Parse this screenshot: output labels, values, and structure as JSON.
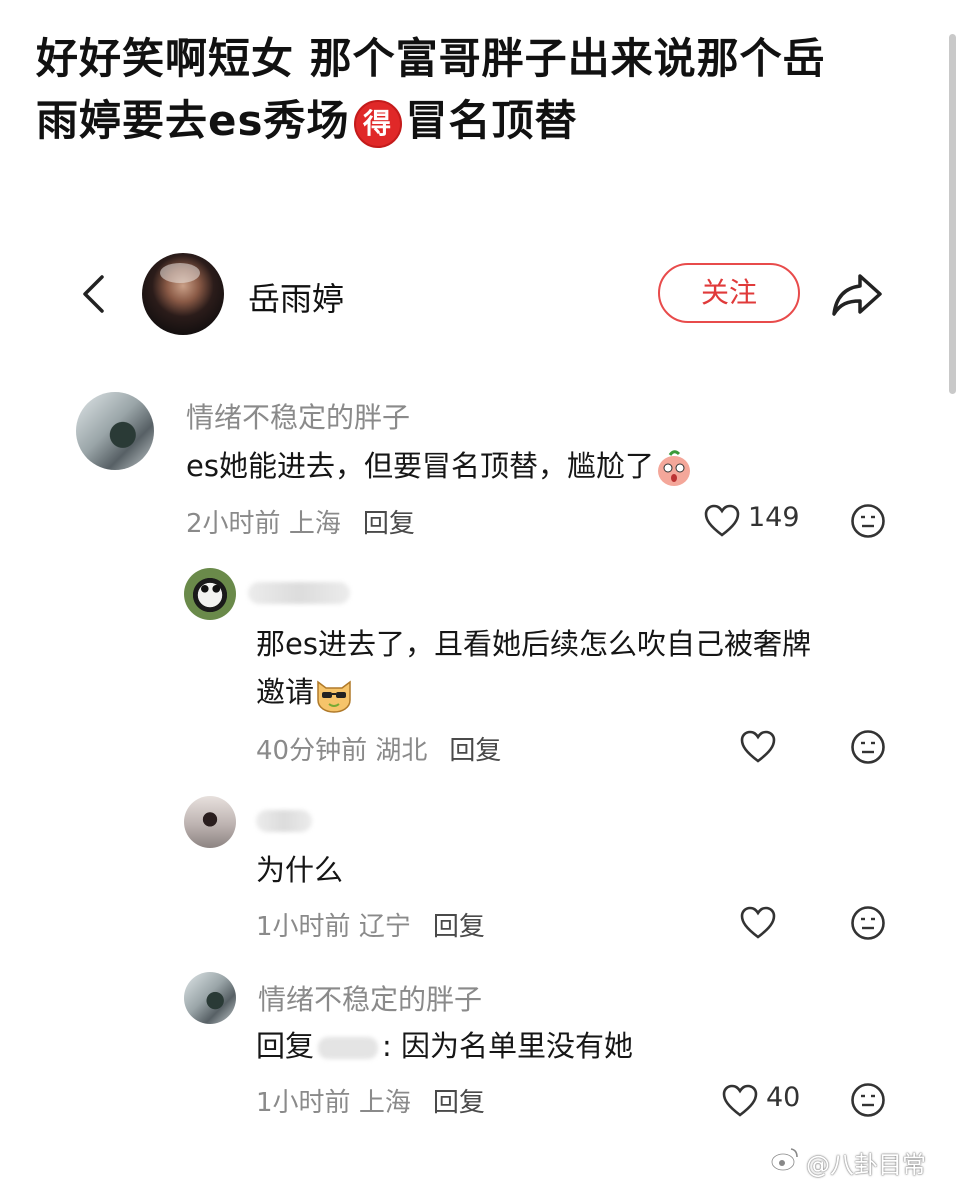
{
  "caption": {
    "line1": "好好笑啊短女 那个富哥胖子出来说那个岳",
    "line2_a": "雨婷要去es秀场",
    "badge": "得",
    "line2_b": "冒名顶替"
  },
  "header": {
    "profile_name": "岳雨婷",
    "follow_label": "关注"
  },
  "comments": [
    {
      "username": "情绪不稳定的胖子",
      "text": "es她能进去，但要冒名顶替，尴尬了",
      "time": "2小时前",
      "location": "上海",
      "reply_label": "回复",
      "likes": "149"
    },
    {
      "username": "",
      "text_line1": "那es进去了，且看她后续怎么吹自己被奢牌",
      "text_line2": "邀请",
      "time": "40分钟前",
      "location": "湖北",
      "reply_label": "回复",
      "likes": ""
    },
    {
      "username": "",
      "text": "为什么",
      "time": "1小时前",
      "location": "辽宁",
      "reply_label": "回复",
      "likes": ""
    },
    {
      "username": "情绪不稳定的胖子",
      "reply_prefix": "回复",
      "text": ": 因为名单里没有她",
      "time": "1小时前",
      "location": "上海",
      "reply_label": "回复",
      "likes": "40"
    }
  ],
  "watermark": "@八卦目常",
  "colors": {
    "accent": "#e84b4b",
    "badge": "#e02828",
    "muted": "#8a8a8a"
  }
}
